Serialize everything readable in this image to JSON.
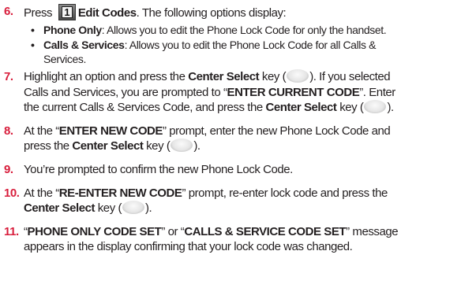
{
  "steps": [
    {
      "num": "6.",
      "lines": [
        {
          "pre": "Press ",
          "key_label": "1",
          "bold": "Edit Codes",
          "post": ". The following options display:"
        }
      ]
    },
    {
      "num": "7.",
      "lines": [
        {
          "pre": "Highlight an option and press the ",
          "bold": "Center Select",
          "post": " key (",
          "tail": "). If you selected"
        },
        {
          "pre": "Calls and Services, you are prompted to “",
          "bold": "ENTER CURRENT CODE",
          "post": "”. Enter"
        },
        {
          "pre": "the current Calls & Services Code, and press the ",
          "bold": "Center Select",
          "post": " key (",
          "tail": ")."
        }
      ]
    },
    {
      "num": "8.",
      "lines": [
        {
          "pre": "At the “",
          "bold": "ENTER NEW CODE",
          "post": "” prompt, enter the new Phone Lock Code and"
        },
        {
          "pre": "press the ",
          "bold": "Center Select",
          "post": " key (",
          "tail": ")."
        }
      ]
    },
    {
      "num": "9.",
      "lines": [
        {
          "pre": "You’re prompted to confirm the new Phone Lock Code."
        }
      ]
    },
    {
      "num": "10.",
      "lines": [
        {
          "pre": "At the “",
          "bold": "RE-ENTER NEW CODE",
          "post": "” prompt, re-enter lock code and press the"
        },
        {
          "bold": "Center Select",
          "post": " key (",
          "tail": ")."
        }
      ]
    },
    {
      "num": "11.",
      "lines": [
        {
          "pre": "“",
          "bold": "PHONE ONLY CODE SET",
          "post": "” or “",
          "bold2": "CALLS & SERVICE CODE SET",
          "post2": "” message"
        },
        {
          "pre": "appears in the display confirming that your lock code was changed."
        }
      ]
    }
  ],
  "bullets": [
    {
      "marker": "•",
      "lines": [
        {
          "bold": "Phone Only",
          "post": ": Allows you to edit the Phone Lock Code for only the handset."
        }
      ]
    },
    {
      "marker": "•",
      "lines": [
        {
          "bold": "Calls & Services",
          "post": ": Allows you to edit the Phone Lock Code for all Calls &"
        },
        {
          "pre": "Services."
        }
      ]
    }
  ],
  "colors": {
    "step_number": "#d81e3c",
    "text": "#231f20"
  },
  "icons": {
    "key": "key-1-icon",
    "center": "center-select-key-icon"
  }
}
